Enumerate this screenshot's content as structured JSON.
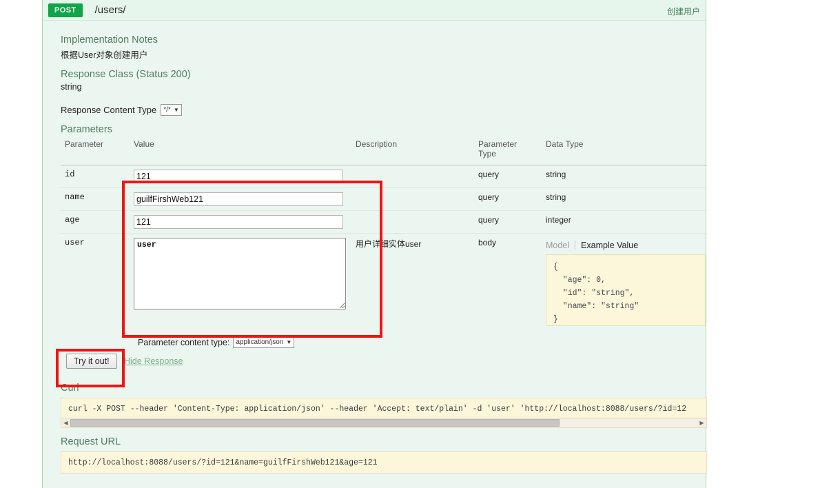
{
  "operation": {
    "method": "POST",
    "path": "/users/",
    "summary": "创建用户"
  },
  "sections": {
    "implementation_notes_title": "Implementation Notes",
    "implementation_notes_text": "根据User对象创建用户",
    "response_class_title": "Response Class (Status 200)",
    "response_class_text": "string",
    "response_content_type_label": "Response Content Type",
    "response_content_type_value": "*/*",
    "parameters_title": "Parameters",
    "curl_title": "Curl",
    "request_url_title": "Request URL"
  },
  "table": {
    "headers": {
      "parameter": "Parameter",
      "value": "Value",
      "description": "Description",
      "parameter_type": "Parameter\nType",
      "parameter_type_line1": "Parameter",
      "parameter_type_line2": "Type",
      "data_type": "Data Type"
    },
    "rows": [
      {
        "parameter": "id",
        "value": "121",
        "description": "",
        "parameter_type": "query",
        "data_type": "string"
      },
      {
        "parameter": "name",
        "value": "guilfFirshWeb121",
        "description": "",
        "parameter_type": "query",
        "data_type": "string"
      },
      {
        "parameter": "age",
        "value": "121",
        "description": "",
        "parameter_type": "query",
        "data_type": "integer"
      },
      {
        "parameter": "user",
        "value": "user",
        "description": "用户详细实体user",
        "parameter_type": "body",
        "data_type": ""
      }
    ]
  },
  "model_tabs": {
    "model": "Model",
    "example_value": "Example Value"
  },
  "example_value_json": "{\n  \"age\": 0,\n  \"id\": \"string\",\n  \"name\": \"string\"\n}",
  "actions": {
    "parameter_content_type_label": "Parameter content type:",
    "parameter_content_type_value": "application/json",
    "try_it_out": "Try it out!",
    "hide_response": "Hide Response"
  },
  "curl_command": "curl -X POST --header 'Content-Type: application/json' --header 'Accept: text/plain' -d 'user' 'http://localhost:8088/users/?id=12",
  "request_url": "http://localhost:8088/users/?id=121&name=guilfFirshWeb121&age=121",
  "colors": {
    "method_green": "#10a54a",
    "heading_green": "#4f7f5f",
    "panel_bg": "#ecf6f0",
    "code_bg": "#fcf6db",
    "annotation_red": "#f01414"
  },
  "icons": {
    "select_caret": "▼",
    "scroll_left": "◀",
    "scroll_right": "▶"
  }
}
